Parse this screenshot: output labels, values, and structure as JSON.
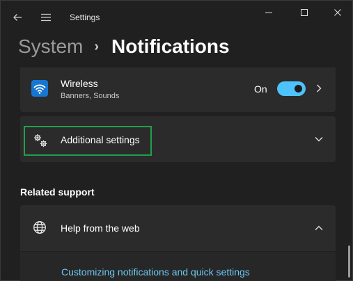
{
  "window": {
    "title": "Settings"
  },
  "breadcrumb": {
    "parent": "System",
    "separator": "›",
    "current": "Notifications"
  },
  "wireless": {
    "title": "Wireless",
    "subtitle": "Banners, Sounds",
    "toggle_label": "On",
    "toggle_on": true,
    "icon": "wifi-icon"
  },
  "additional": {
    "label": "Additional settings",
    "icon": "gears-icon"
  },
  "related_support": {
    "heading": "Related support",
    "help": {
      "label": "Help from the web",
      "icon": "globe-icon",
      "link": "Customizing notifications and quick settings"
    }
  },
  "colors": {
    "accent": "#4cc2ff",
    "highlight": "#21a04a",
    "link": "#6bc8f2",
    "background": "#202020",
    "card": "#2b2b2b"
  }
}
